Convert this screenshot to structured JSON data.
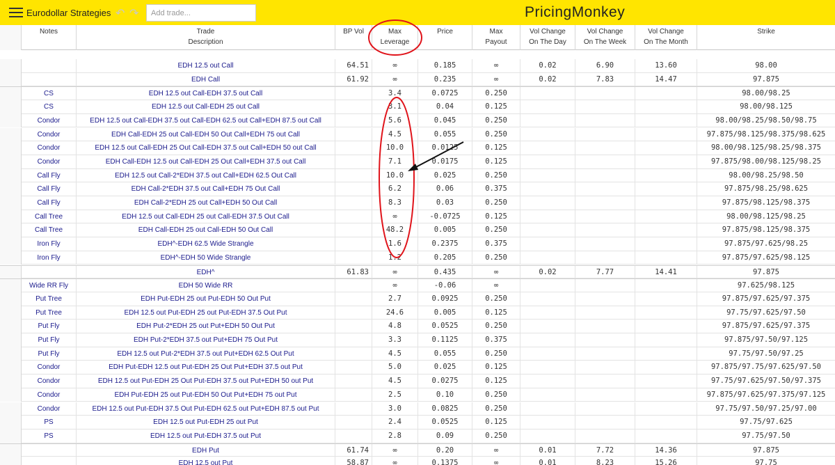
{
  "topbar": {
    "menu_icon": "hamburger-menu-icon",
    "title": "Eurodollar Strategies",
    "undo_icon": "undo-icon",
    "redo_icon": "redo-icon",
    "add_trade_placeholder": "Add trade...",
    "brand": "PricingMonkey",
    "bar_color": "#ffe500"
  },
  "header": {
    "notes": "Notes",
    "trade": "Trade",
    "description": "Description",
    "bp_vol": "BP Vol",
    "max_leverage_1": "Max",
    "max_leverage_2": "Leverage",
    "price": "Price",
    "max_payout_1": "Max",
    "max_payout_2": "Payout",
    "vol_day_1": "Vol Change",
    "vol_day_2": "On The Day",
    "vol_week_1": "Vol Change",
    "vol_week_2": "On The Week",
    "vol_month_1": "Vol Change",
    "vol_month_2": "On The Month",
    "strike": "Strike"
  },
  "annotation_color": "#e0131a",
  "rows": [
    {
      "notes": "",
      "desc": "EDH 12.5 out Call",
      "bpvol": "64.51",
      "lev": "∞",
      "price": "0.185",
      "payout": "∞",
      "day": "0.02",
      "week": "6.90",
      "month": "13.60",
      "strike": "98.00"
    },
    {
      "notes": "",
      "desc": "EDH Call",
      "bpvol": "61.92",
      "lev": "∞",
      "price": "0.235",
      "payout": "∞",
      "day": "0.02",
      "week": "7.83",
      "month": "14.47",
      "strike": "97.875"
    },
    {
      "notes": "CS",
      "desc": "EDH 12.5 out Call-EDH 37.5 out Call",
      "bpvol": "",
      "lev": "3.4",
      "price": "0.0725",
      "payout": "0.250",
      "day": "",
      "week": "",
      "month": "",
      "strike": "98.00/98.25"
    },
    {
      "notes": "CS",
      "desc": "EDH 12.5 out Call-EDH 25 out Call",
      "bpvol": "",
      "lev": "3.1",
      "price": "0.04",
      "payout": "0.125",
      "day": "",
      "week": "",
      "month": "",
      "strike": "98.00/98.125"
    },
    {
      "notes": "Condor",
      "desc": "EDH 12.5 out Call-EDH 37.5 out Call-EDH 62.5 out Call+EDH 87.5 out Call",
      "bpvol": "",
      "lev": "5.6",
      "price": "0.045",
      "payout": "0.250",
      "day": "",
      "week": "",
      "month": "",
      "strike": "98.00/98.25/98.50/98.75"
    },
    {
      "notes": "Condor",
      "desc": "EDH Call-EDH 25 out Call-EDH 50 Out Call+EDH 75 out Call",
      "bpvol": "",
      "lev": "4.5",
      "price": "0.055",
      "payout": "0.250",
      "day": "",
      "week": "",
      "month": "",
      "strike": "97.875/98.125/98.375/98.625"
    },
    {
      "notes": "Condor",
      "desc": "EDH 12.5 out Call-EDH 25 Out Call-EDH 37.5 out Call+EDH 50 out Call",
      "bpvol": "",
      "lev": "10.0",
      "price": "0.0125",
      "payout": "0.125",
      "day": "",
      "week": "",
      "month": "",
      "strike": "98.00/98.125/98.25/98.375"
    },
    {
      "notes": "Condor",
      "desc": "EDH Call-EDH 12.5 out Call-EDH 25 Out Call+EDH 37.5 out Call",
      "bpvol": "",
      "lev": "7.1",
      "price": "0.0175",
      "payout": "0.125",
      "day": "",
      "week": "",
      "month": "",
      "strike": "97.875/98.00/98.125/98.25"
    },
    {
      "notes": "Call Fly",
      "desc": "EDH 12.5 out Call-2*EDH 37.5 out Call+EDH 62.5 Out Call",
      "bpvol": "",
      "lev": "10.0",
      "price": "0.025",
      "payout": "0.250",
      "day": "",
      "week": "",
      "month": "",
      "strike": "98.00/98.25/98.50"
    },
    {
      "notes": "Call Fly",
      "desc": "EDH Call-2*EDH 37.5 out Call+EDH 75 Out Call",
      "bpvol": "",
      "lev": "6.2",
      "price": "0.06",
      "payout": "0.375",
      "day": "",
      "week": "",
      "month": "",
      "strike": "97.875/98.25/98.625"
    },
    {
      "notes": "Call Fly",
      "desc": "EDH Call-2*EDH 25 out Call+EDH 50 Out Call",
      "bpvol": "",
      "lev": "8.3",
      "price": "0.03",
      "payout": "0.250",
      "day": "",
      "week": "",
      "month": "",
      "strike": "97.875/98.125/98.375"
    },
    {
      "notes": "Call Tree",
      "desc": "EDH 12.5 out Call-EDH 25 out Call-EDH 37.5 Out Call",
      "bpvol": "",
      "lev": "∞",
      "price": "-0.0725",
      "payout": "0.125",
      "day": "",
      "week": "",
      "month": "",
      "strike": "98.00/98.125/98.25"
    },
    {
      "notes": "Call Tree",
      "desc": "EDH Call-EDH 25 out Call-EDH 50 Out Call",
      "bpvol": "",
      "lev": "48.2",
      "price": "0.005",
      "payout": "0.250",
      "day": "",
      "week": "",
      "month": "",
      "strike": "97.875/98.125/98.375"
    },
    {
      "notes": "Iron Fly",
      "desc": "EDH^-EDH 62.5 Wide Strangle",
      "bpvol": "",
      "lev": "1.6",
      "price": "0.2375",
      "payout": "0.375",
      "day": "",
      "week": "",
      "month": "",
      "strike": "97.875/97.625/98.25"
    },
    {
      "notes": "Iron Fly",
      "desc": "EDH^-EDH 50 Wide Strangle",
      "bpvol": "",
      "lev": "1.2",
      "price": "0.205",
      "payout": "0.250",
      "day": "",
      "week": "",
      "month": "",
      "strike": "97.875/97.625/98.125"
    },
    {
      "notes": "",
      "desc": "EDH^",
      "bpvol": "61.83",
      "lev": "∞",
      "price": "0.435",
      "payout": "∞",
      "day": "0.02",
      "week": "7.77",
      "month": "14.41",
      "strike": "97.875"
    },
    {
      "notes": "Wide RR Fly",
      "desc": "EDH 50 Wide RR",
      "bpvol": "",
      "lev": "∞",
      "price": "-0.06",
      "payout": "∞",
      "day": "",
      "week": "",
      "month": "",
      "strike": "97.625/98.125"
    },
    {
      "notes": "Put Tree",
      "desc": "EDH Put-EDH 25 out Put-EDH 50 Out Put",
      "bpvol": "",
      "lev": "2.7",
      "price": "0.0925",
      "payout": "0.250",
      "day": "",
      "week": "",
      "month": "",
      "strike": "97.875/97.625/97.375"
    },
    {
      "notes": "Put Tree",
      "desc": "EDH 12.5 out Put-EDH 25 out Put-EDH 37.5 Out Put",
      "bpvol": "",
      "lev": "24.6",
      "price": "0.005",
      "payout": "0.125",
      "day": "",
      "week": "",
      "month": "",
      "strike": "97.75/97.625/97.50"
    },
    {
      "notes": "Put Fly",
      "desc": "EDH Put-2*EDH 25 out Put+EDH 50 Out Put",
      "bpvol": "",
      "lev": "4.8",
      "price": "0.0525",
      "payout": "0.250",
      "day": "",
      "week": "",
      "month": "",
      "strike": "97.875/97.625/97.375"
    },
    {
      "notes": "Put Fly",
      "desc": "EDH Put-2*EDH 37.5 out Put+EDH 75 Out Put",
      "bpvol": "",
      "lev": "3.3",
      "price": "0.1125",
      "payout": "0.375",
      "day": "",
      "week": "",
      "month": "",
      "strike": "97.875/97.50/97.125"
    },
    {
      "notes": "Put Fly",
      "desc": "EDH 12.5 out Put-2*EDH 37.5 out Put+EDH 62.5 Out Put",
      "bpvol": "",
      "lev": "4.5",
      "price": "0.055",
      "payout": "0.250",
      "day": "",
      "week": "",
      "month": "",
      "strike": "97.75/97.50/97.25"
    },
    {
      "notes": "Condor",
      "desc": "EDH Put-EDH 12.5 out Put-EDH 25 Out Put+EDH 37.5 out Put",
      "bpvol": "",
      "lev": "5.0",
      "price": "0.025",
      "payout": "0.125",
      "day": "",
      "week": "",
      "month": "",
      "strike": "97.875/97.75/97.625/97.50"
    },
    {
      "notes": "Condor",
      "desc": "EDH 12.5 out Put-EDH 25 Out Put-EDH 37.5 out Put+EDH 50 out Put",
      "bpvol": "",
      "lev": "4.5",
      "price": "0.0275",
      "payout": "0.125",
      "day": "",
      "week": "",
      "month": "",
      "strike": "97.75/97.625/97.50/97.375"
    },
    {
      "notes": "Condor",
      "desc": "EDH Put-EDH 25 out Put-EDH 50 Out Put+EDH 75 out Put",
      "bpvol": "",
      "lev": "2.5",
      "price": "0.10",
      "payout": "0.250",
      "day": "",
      "week": "",
      "month": "",
      "strike": "97.875/97.625/97.375/97.125"
    },
    {
      "notes": "Condor",
      "desc": "EDH 12.5 out Put-EDH 37.5 Out Put-EDH 62.5 out Put+EDH 87.5 out Put",
      "bpvol": "",
      "lev": "3.0",
      "price": "0.0825",
      "payout": "0.250",
      "day": "",
      "week": "",
      "month": "",
      "strike": "97.75/97.50/97.25/97.00"
    },
    {
      "notes": "PS",
      "desc": "EDH 12.5 out Put-EDH 25 out Put",
      "bpvol": "",
      "lev": "2.4",
      "price": "0.0525",
      "payout": "0.125",
      "day": "",
      "week": "",
      "month": "",
      "strike": "97.75/97.625"
    },
    {
      "notes": "PS",
      "desc": "EDH 12.5 out Put-EDH 37.5 out Put",
      "bpvol": "",
      "lev": "2.8",
      "price": "0.09",
      "payout": "0.250",
      "day": "",
      "week": "",
      "month": "",
      "strike": "97.75/97.50"
    },
    {
      "notes": "",
      "desc": "EDH Put",
      "bpvol": "61.74",
      "lev": "∞",
      "price": "0.20",
      "payout": "∞",
      "day": "0.01",
      "week": "7.72",
      "month": "14.36",
      "strike": "97.875"
    },
    {
      "notes": "",
      "desc": "EDH 12.5 out Put",
      "bpvol": "58.87",
      "lev": "∞",
      "price": "0.1375",
      "payout": "∞",
      "day": "0.01",
      "week": "8.23",
      "month": "15.26",
      "strike": "97.75"
    }
  ]
}
